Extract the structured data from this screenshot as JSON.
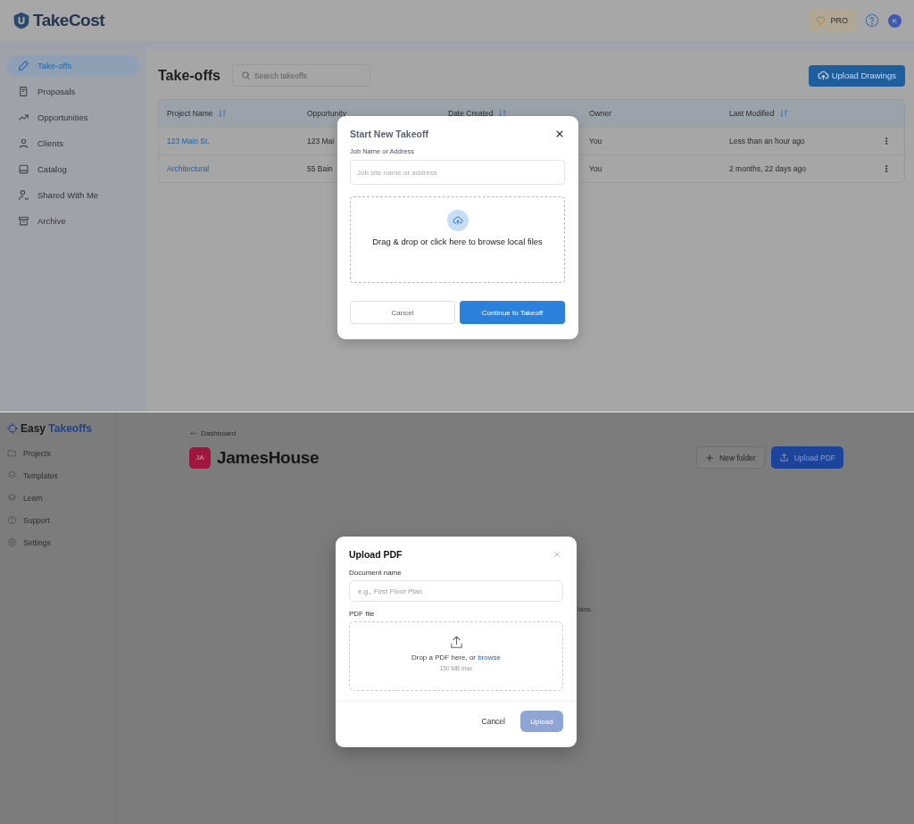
{
  "top_screen": {
    "header": {
      "logo": "TakeCost",
      "plan_badge": "PRO",
      "avatar": "K"
    },
    "sidebar": {
      "items": [
        {
          "label": "Take-offs",
          "selected": true
        },
        {
          "label": "Proposals",
          "selected": false
        },
        {
          "label": "Opportunities",
          "selected": false
        },
        {
          "label": "Clients",
          "selected": false
        },
        {
          "label": "Catalog",
          "selected": false
        },
        {
          "label": "Shared With Me",
          "selected": false
        },
        {
          "label": "Archive",
          "selected": false
        }
      ]
    },
    "page": {
      "title": "Take-offs",
      "search": {
        "placeholder": "Search takeoffs"
      },
      "upload_button": "Upload Drawings"
    },
    "table": {
      "columns": [
        {
          "label": "Project Name",
          "sortable": true
        },
        {
          "label": "Opportunity",
          "sortable": false
        },
        {
          "label": "Date Created",
          "sortable": true
        },
        {
          "label": "Owner",
          "sortable": false
        },
        {
          "label": "Last Modified",
          "sortable": true
        }
      ],
      "rows": [
        {
          "project_name": "123 Main St.",
          "opportunity": "123 Mai",
          "owner": "You",
          "last_modified": "Less than an hour ago"
        },
        {
          "project_name": "Architectural",
          "opportunity": "55 Bain",
          "owner": "You",
          "last_modified": "2 months, 22 days ago"
        }
      ]
    },
    "dialog": {
      "title": "Start New Takeoff",
      "field_label": "Job Name or Address",
      "placeholder": "Job site name or address",
      "dropzone_text": "Drag & drop or click here to browse local files",
      "cancel_button": "Cancel",
      "confirm_button": "Continue to Takeoff"
    }
  },
  "bottom_screen": {
    "logo": {
      "first": "Easy",
      "second": "Takeoffs"
    },
    "sidebar": {
      "items": [
        {
          "label": "Projects"
        },
        {
          "label": "Templates"
        },
        {
          "label": "Learn"
        },
        {
          "label": "Support"
        },
        {
          "label": "Settings"
        }
      ]
    },
    "breadcrumb": "Dashboard",
    "project": {
      "initials": "JA",
      "color": "#a0163f",
      "title": "JamesHouse"
    },
    "buttons": {
      "new_folder": "New folder",
      "upload": "Upload PDF"
    },
    "background_text": "lans.",
    "dialog": {
      "title": "Upload PDF",
      "field_label": "Document name",
      "placeholder": "e.g., First Floor Plan",
      "file_label": "PDF file",
      "drop_text": "Drop a PDF here, or",
      "browse_link": "browse",
      "size_hint": "150 MB max",
      "cancel_button": "Cancel",
      "upload_button": {
        "label": "Upload",
        "disabled": true
      }
    }
  }
}
